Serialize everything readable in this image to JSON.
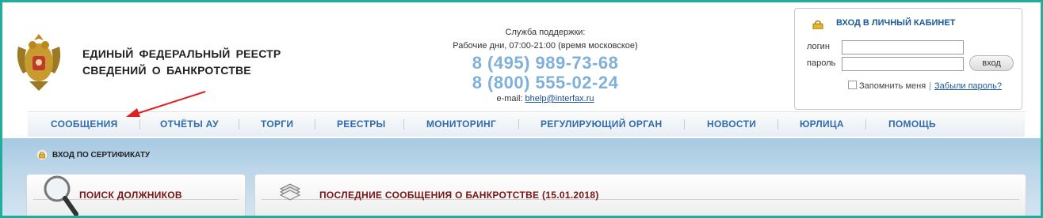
{
  "header": {
    "title_line1": "ЕДИНЫЙ  ФЕДЕРАЛЬНЫЙ  РЕЕСТР",
    "title_line2": "СВЕДЕНИЙ  О  БАНКРОТСТВЕ"
  },
  "support": {
    "label": "Служба поддержки:",
    "hours": "Рабочие дни, 07:00-21:00 (время московское)",
    "phone1": "8 (495) 989-73-68",
    "phone2": "8 (800) 555-02-24",
    "email_label": "e-mail:",
    "email": "bhelp@interfax.ru"
  },
  "login": {
    "title": "ВХОД В ЛИЧНЫЙ КАБИНЕТ",
    "login_label": "логин",
    "password_label": "пароль",
    "submit": "вход",
    "remember": "Запомнить меня",
    "separator": "|",
    "forgot": "Забыли пароль?"
  },
  "nav": {
    "items": [
      "СООБЩЕНИЯ",
      "ОТЧЁТЫ АУ",
      "ТОРГИ",
      "РЕЕСТРЫ",
      "МОНИТОРИНГ",
      "РЕГУЛИРУЮЩИЙ ОРГАН",
      "НОВОСТИ",
      "ЮРЛИЦА",
      "ПОМОЩЬ"
    ]
  },
  "cert_login": "ВХОД ПО СЕРТИФИКАТУ",
  "panels": {
    "left_title": "ПОИСК ДОЛЖНИКОВ",
    "right_title": "ПОСЛЕДНИЕ СООБЩЕНИЯ О БАНКРОТСТВЕ (15.01.2018)"
  },
  "colors": {
    "frame": "#1fae9a",
    "phone": "#7fb0d9",
    "nav_text": "#2d6cb0",
    "panel_title": "#7a1414",
    "arrow": "#e02020"
  }
}
